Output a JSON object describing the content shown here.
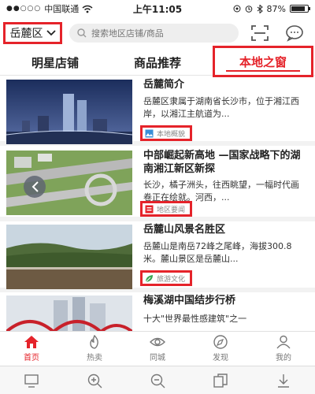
{
  "status_bar": {
    "signal": "●●○○○",
    "carrier": "中国联通",
    "time": "上午11:05",
    "battery_text": "87%",
    "battery_level": 0.87
  },
  "header": {
    "city": "岳麓区",
    "search_placeholder": "搜索地区店铺/商品"
  },
  "tabs": [
    {
      "label": "明星店铺",
      "active": false
    },
    {
      "label": "商品推荐",
      "active": false
    },
    {
      "label": "本地之窗",
      "active": true
    }
  ],
  "articles": [
    {
      "title": "岳麓简介",
      "desc": "岳麓区隶属于湖南省长沙市，位于湘江西岸，以湘江主航道为...",
      "tag": "本地概貌"
    },
    {
      "title": "中部崛起新高地 —国家战略下的湖南湘江新区新探",
      "desc": "长沙，橘子洲头，往西眺望，一幅时代画卷正在绘就。河西，...",
      "tag": "地区要闻"
    },
    {
      "title": "岳麓山风景名胜区",
      "desc": "岳麓山是南岳72峰之尾峰，海拔300.8米。麓山景区是岳麓山...",
      "tag": "旅游文化"
    },
    {
      "title": "梅溪湖中国结步行桥",
      "desc": "十大\"世界最性感建筑\"之一",
      "tag": ""
    }
  ],
  "bottom_nav": [
    {
      "label": "首页",
      "icon": "home-icon",
      "active": true
    },
    {
      "label": "热卖",
      "icon": "flame-icon",
      "active": false
    },
    {
      "label": "同城",
      "icon": "eye-icon",
      "active": false
    },
    {
      "label": "发现",
      "icon": "compass-icon",
      "active": false
    },
    {
      "label": "我的",
      "icon": "user-icon",
      "active": false
    }
  ],
  "colors": {
    "accent": "#e5232a",
    "text": "#222222",
    "muted": "#888888"
  }
}
